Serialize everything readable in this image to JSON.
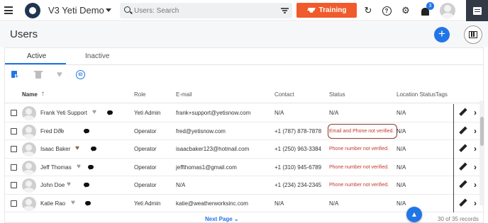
{
  "header": {
    "app_title": "V3 Yeti Demo",
    "search_placeholder": "Users: Search",
    "training_label": "Training",
    "notification_count": "3"
  },
  "page": {
    "title": "Users",
    "add_symbol": "+"
  },
  "tabs": [
    {
      "label": "Active",
      "selected": true
    },
    {
      "label": "Inactive",
      "selected": false
    }
  ],
  "table": {
    "columns": [
      "Name",
      "Role",
      "E-mail",
      "Contact",
      "Status",
      "Location Status",
      "Tags"
    ],
    "sort_indicator": "↑",
    "rows": [
      {
        "name": "Frank Yeti Support",
        "favorite": false,
        "role": "Yeti Admin",
        "email": "frank+support@yetisnow.com",
        "contact": "N/A",
        "status": "N/A",
        "status_warning": false,
        "location_status": "N/A"
      },
      {
        "name": "Fred Doe",
        "favorite": false,
        "role": "Operator",
        "email": "fred@yetisnow.com",
        "contact": "+1 (787) 878-7878",
        "status": "Email and Phone not verified.",
        "status_warning": true,
        "location_status": "N/A"
      },
      {
        "name": "Isaac Baker",
        "favorite": true,
        "role": "Operator",
        "email": "isaacbaker123@hotmail.com",
        "contact": "+1 (250) 963-3384",
        "status": "Phone number not verified.",
        "status_warning": true,
        "location_status": "N/A"
      },
      {
        "name": "Jeff Thomas",
        "favorite": false,
        "role": "Operator",
        "email": "jeffthomas1@gmail.com",
        "contact": "+1 (310) 945-6789",
        "status": "Phone number not verified.",
        "status_warning": true,
        "location_status": "N/A"
      },
      {
        "name": "John Doe",
        "favorite": false,
        "role": "Operator",
        "email": "N/A",
        "contact": "+1 (234) 234-2345",
        "status": "Phone number not verified.",
        "status_warning": true,
        "location_status": "N/A"
      },
      {
        "name": "Katie Rao",
        "favorite": false,
        "role": "Yeti Admin",
        "email": "katie@weatherworksinc.com",
        "contact": "N/A",
        "status": "N/A",
        "status_warning": false,
        "location_status": "N/A"
      }
    ]
  },
  "footer": {
    "next_page_label": "Next Page",
    "records_label": "30 of 35 records"
  },
  "colors": {
    "accent": "#2176e6",
    "training": "#f05b2c",
    "warning": "#c0392b"
  },
  "icons": [
    "menu-icon",
    "search-icon",
    "filter-icon",
    "graduation-cap-icon",
    "refresh-icon",
    "help-icon",
    "gear-icon",
    "bell-icon",
    "user-avatar",
    "chat-icon",
    "add-icon",
    "grid-icon",
    "export-icon",
    "trash-icon",
    "heart-icon",
    "badge-icon",
    "pencil-icon",
    "chevron-right-icon",
    "arrow-up-icon"
  ]
}
